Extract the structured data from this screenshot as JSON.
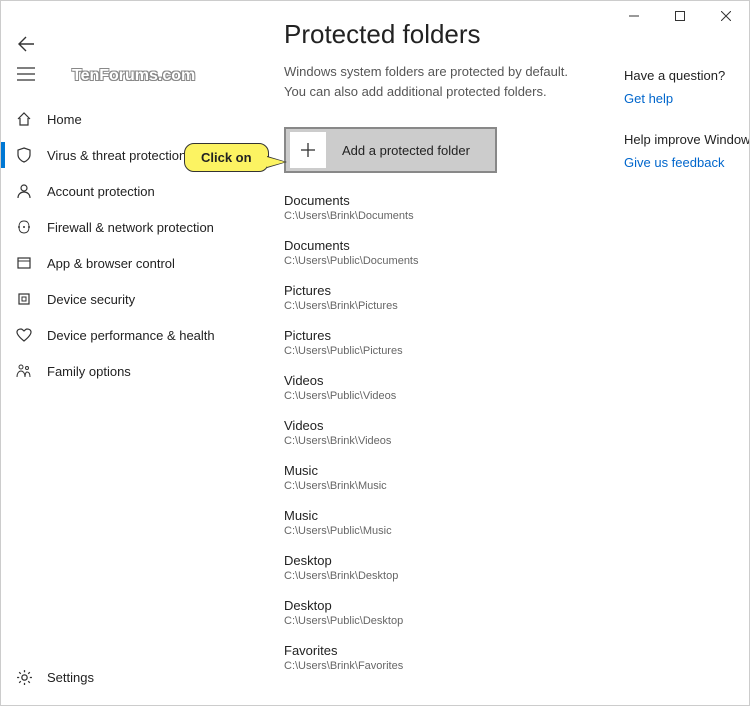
{
  "watermark": "TenForums.com",
  "callout": "Click on",
  "page": {
    "title": "Protected folders",
    "description": "Windows system folders are protected by default. You can also add additional protected folders."
  },
  "sidebar": {
    "items": [
      {
        "label": "Home"
      },
      {
        "label": "Virus & threat protection"
      },
      {
        "label": "Account protection"
      },
      {
        "label": "Firewall & network protection"
      },
      {
        "label": "App & browser control"
      },
      {
        "label": "Device security"
      },
      {
        "label": "Device performance & health"
      },
      {
        "label": "Family options"
      }
    ],
    "settings": "Settings"
  },
  "add_button": "Add a protected folder",
  "folders": [
    {
      "name": "Documents",
      "path": "C:\\Users\\Brink\\Documents"
    },
    {
      "name": "Documents",
      "path": "C:\\Users\\Public\\Documents"
    },
    {
      "name": "Pictures",
      "path": "C:\\Users\\Brink\\Pictures"
    },
    {
      "name": "Pictures",
      "path": "C:\\Users\\Public\\Pictures"
    },
    {
      "name": "Videos",
      "path": "C:\\Users\\Public\\Videos"
    },
    {
      "name": "Videos",
      "path": "C:\\Users\\Brink\\Videos"
    },
    {
      "name": "Music",
      "path": "C:\\Users\\Brink\\Music"
    },
    {
      "name": "Music",
      "path": "C:\\Users\\Public\\Music"
    },
    {
      "name": "Desktop",
      "path": "C:\\Users\\Brink\\Desktop"
    },
    {
      "name": "Desktop",
      "path": "C:\\Users\\Public\\Desktop"
    },
    {
      "name": "Favorites",
      "path": "C:\\Users\\Brink\\Favorites"
    }
  ],
  "right": {
    "question_heading": "Have a question?",
    "question_link": "Get help",
    "improve_heading": "Help improve Windows Security",
    "improve_link": "Give us feedback"
  }
}
